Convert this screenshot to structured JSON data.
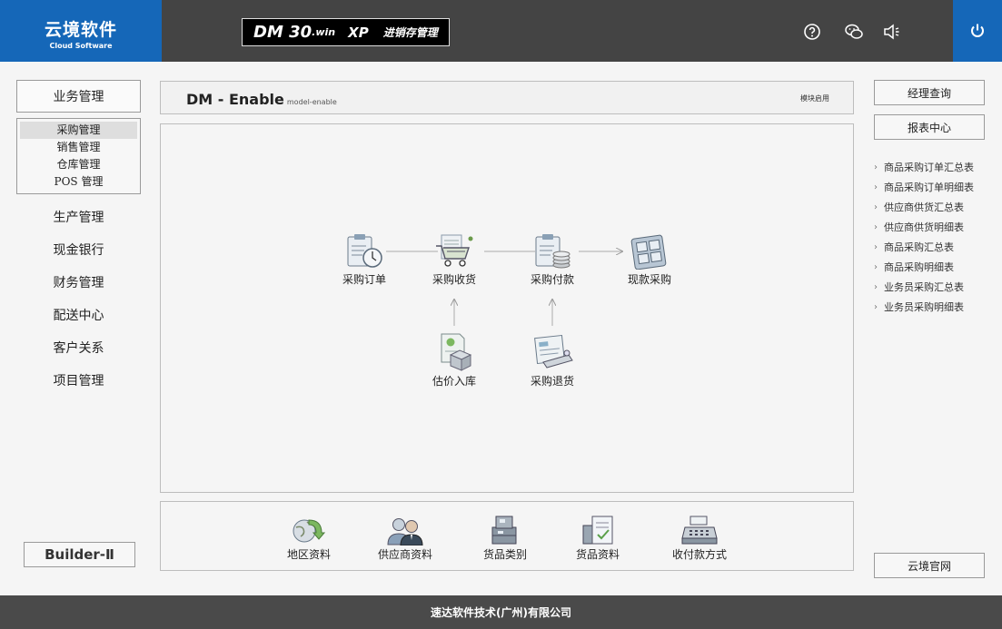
{
  "header": {
    "brand_cn": "云境软件",
    "brand_en": "Cloud Software",
    "product_dm": "DM 30",
    "product_win": ".win",
    "product_xp": "XP",
    "product_title": "进销存管理",
    "icons": [
      "help-icon",
      "wechat-icon",
      "sound-icon",
      "power-icon"
    ]
  },
  "left_nav": {
    "head": "业务管理",
    "submenu": [
      "采购管理",
      "销售管理",
      "仓库管理",
      "POS 管理"
    ],
    "items": [
      "生产管理",
      "现金银行",
      "财务管理",
      "配送中心",
      "客户关系",
      "项目管理"
    ],
    "builder": "Builder-Ⅱ"
  },
  "panel": {
    "title": "DM - Enable",
    "subtitle": "model-enable",
    "right_label": "模块启用"
  },
  "flow": {
    "nodes": [
      "采购订单",
      "采购收货",
      "采购付款",
      "现款采购",
      "估价入库",
      "采购退货"
    ]
  },
  "bottom": {
    "items": [
      "地区资料",
      "供应商资料",
      "货品类别",
      "货品资料",
      "收付款方式"
    ]
  },
  "right": {
    "btn1": "经理查询",
    "btn2": "报表中心",
    "reports": [
      "商品采购订单汇总表",
      "商品采购订单明细表",
      "供应商供货汇总表",
      "供应商供货明细表",
      "商品采购汇总表",
      "商品采购明细表",
      "业务员采购汇总表",
      "业务员采购明细表"
    ],
    "btn3": "云境官网"
  },
  "footer": "速达软件技术(广州)有限公司",
  "colors": {
    "brand_blue": "#1567b8",
    "header_gray": "#444444",
    "footer_gray": "#4a4a4a"
  }
}
